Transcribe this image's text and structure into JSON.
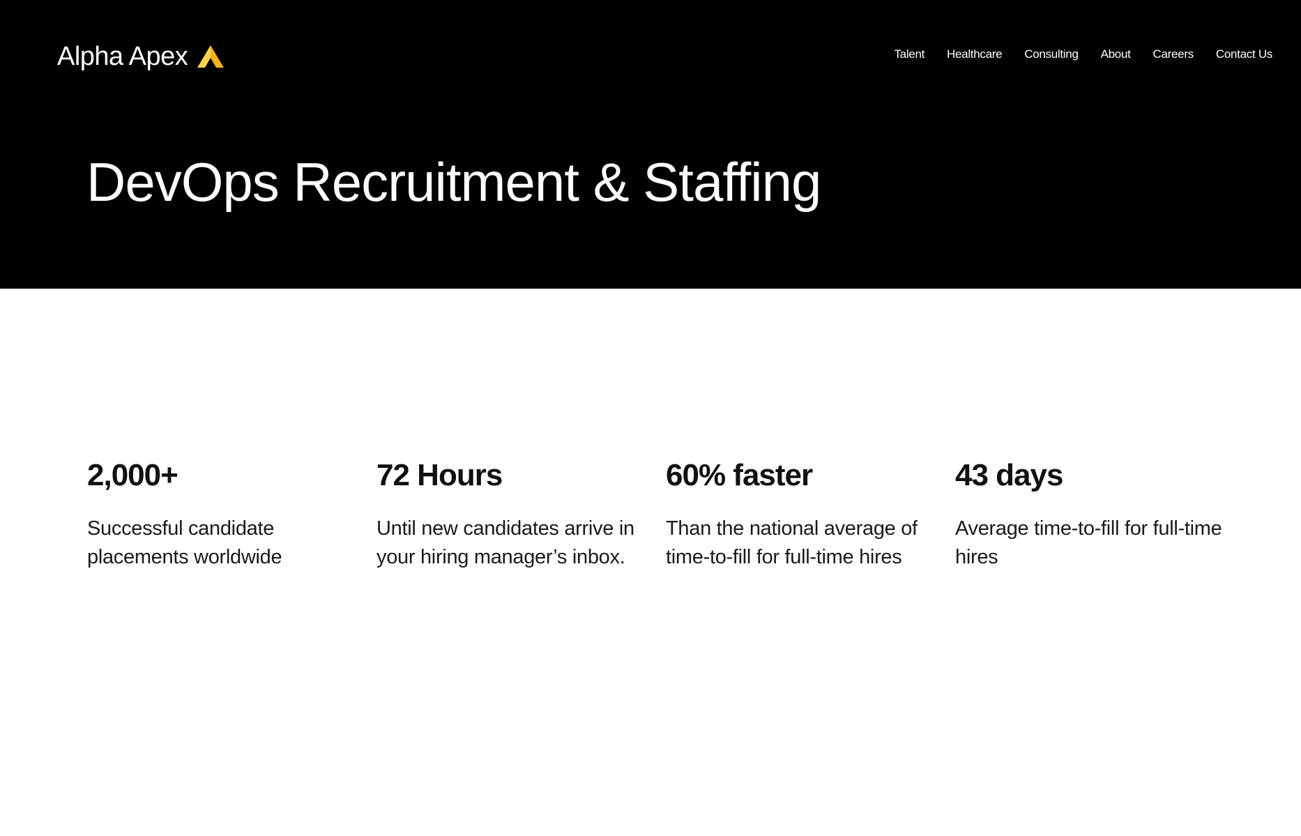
{
  "header": {
    "logo_text": "Alpha Apex",
    "logo_accent_color": "#F5B21B",
    "nav": [
      {
        "label": "Talent"
      },
      {
        "label": "Healthcare"
      },
      {
        "label": "Consulting"
      },
      {
        "label": "About"
      },
      {
        "label": "Careers"
      },
      {
        "label": "Contact Us"
      }
    ]
  },
  "hero": {
    "title": "DevOps Recruitment & Staffing",
    "background_color": "#000000"
  },
  "stats": [
    {
      "value": "2,000+",
      "description": "Successful candidate placements worldwide"
    },
    {
      "value": "72 Hours",
      "description": "Until new candidates arrive in your hiring manager’s inbox."
    },
    {
      "value": "60% faster",
      "description": "Than the national average of time-to-fill for full-time hires"
    },
    {
      "value": "43 days",
      "description": "Average time-to-fill for full-time hires"
    }
  ]
}
